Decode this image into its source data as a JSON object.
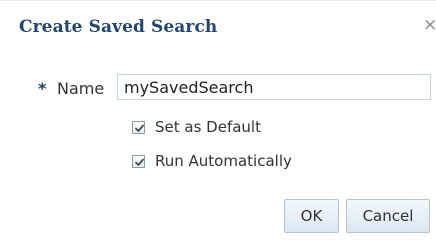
{
  "dialog": {
    "title": "Create Saved Search",
    "close_glyph": "×"
  },
  "form": {
    "name_required_marker": "*",
    "name_label": "Name",
    "name_value": "mySavedSearch",
    "options": [
      {
        "label": "Set as Default",
        "checked": true
      },
      {
        "label": "Run Automatically",
        "checked": true
      }
    ]
  },
  "buttons": {
    "ok_label": "OK",
    "cancel_label": "Cancel"
  },
  "colors": {
    "title": "#23456e",
    "button_bg": "#dde7f1",
    "input_border": "#c9d1d9"
  }
}
